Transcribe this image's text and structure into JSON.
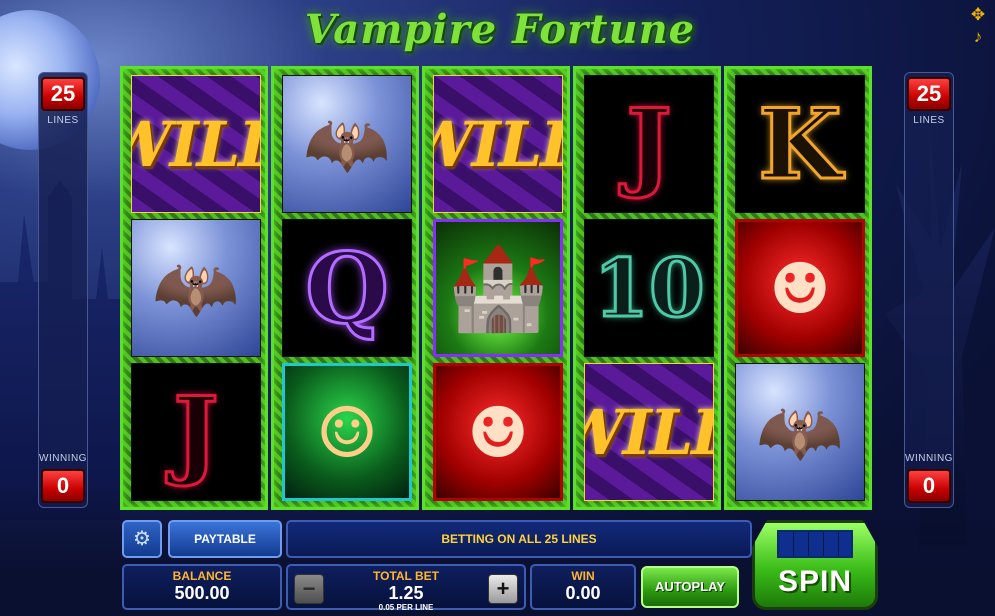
{
  "game": {
    "title": "Vampire Fortune"
  },
  "top_icons": [
    {
      "name": "fullscreen-icon",
      "glyph": "✥"
    },
    {
      "name": "sound-icon",
      "glyph": "🔊"
    }
  ],
  "left_panel": {
    "lines_value": "25",
    "lines_label": "LINES",
    "winning_label": "WINNING",
    "winning_value": "0"
  },
  "right_panel": {
    "lines_value": "25",
    "lines_label": "LINES",
    "winning_label": "WINNING",
    "winning_value": "0"
  },
  "reels": [
    [
      {
        "symbol": "wild",
        "label": "WILD"
      },
      {
        "symbol": "bat",
        "label": ""
      },
      {
        "symbol": "j",
        "label": "J"
      }
    ],
    [
      {
        "symbol": "bat",
        "label": ""
      },
      {
        "symbol": "q",
        "label": "Q"
      },
      {
        "symbol": "girl",
        "label": ""
      }
    ],
    [
      {
        "symbol": "wild",
        "label": "WILD"
      },
      {
        "symbol": "castle",
        "label": ""
      },
      {
        "symbol": "drac",
        "label": ""
      }
    ],
    [
      {
        "symbol": "j",
        "label": "J"
      },
      {
        "symbol": "10",
        "label": "10"
      },
      {
        "symbol": "wild",
        "label": "WILD"
      }
    ],
    [
      {
        "symbol": "k",
        "label": "K"
      },
      {
        "symbol": "drac",
        "label": ""
      },
      {
        "symbol": "bat",
        "label": ""
      }
    ]
  ],
  "controls": {
    "settings_icon": "gear-icon",
    "paytable_label": "PAYTABLE",
    "message": "BETTING ON ALL 25 LINES",
    "balance_label": "BALANCE",
    "balance_value": "500.00",
    "total_bet_label": "TOTAL BET",
    "total_bet_value": "1.25",
    "per_line_text": "0.05 PER LINE",
    "minus_label": "−",
    "plus_label": "+",
    "win_label": "WIN",
    "win_value": "0.00",
    "autoplay_label": "AUTOPLAY",
    "spin_label": "SPIN"
  }
}
